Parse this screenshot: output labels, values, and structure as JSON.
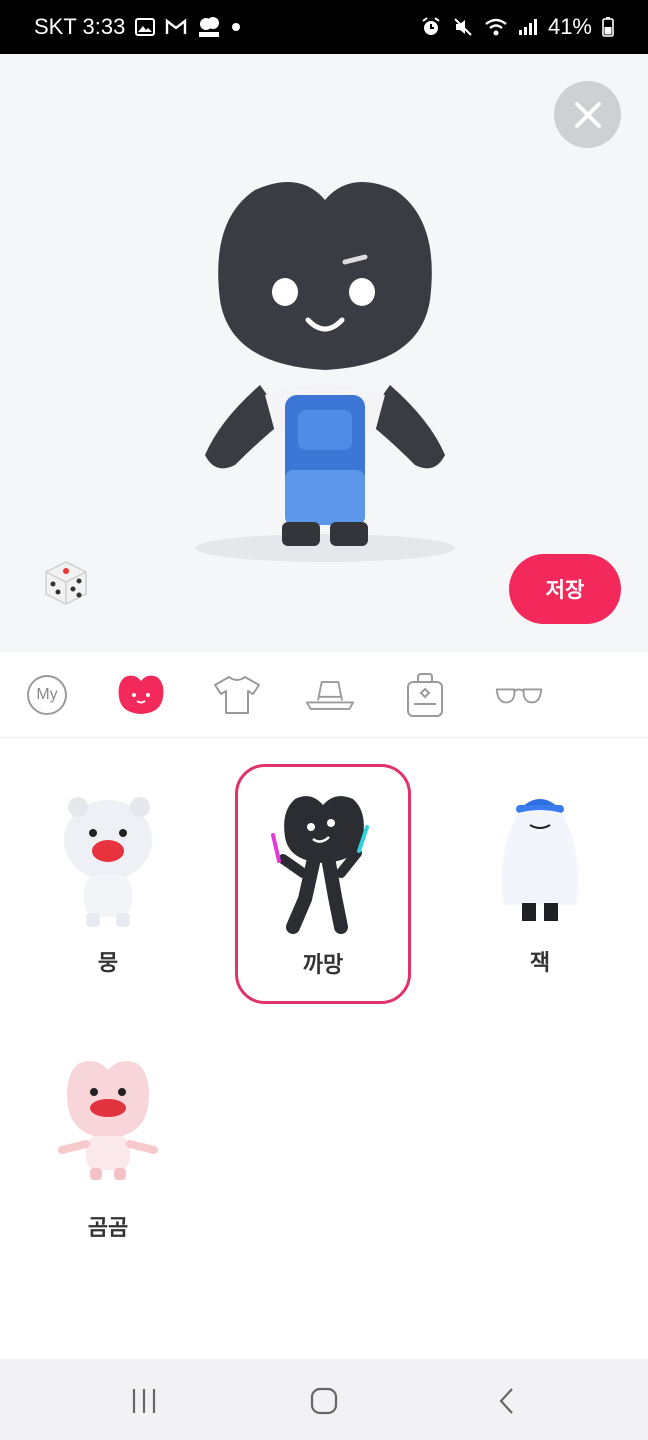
{
  "status": {
    "carrier_time": "SKT 3:33",
    "battery": "41%"
  },
  "preview": {
    "save_label": "저장"
  },
  "tabs": {
    "my_label": "My",
    "items": [
      "my-tab",
      "character-tab",
      "shirt-tab",
      "hat-tab",
      "bag-tab",
      "glasses-tab"
    ],
    "active": "character-tab"
  },
  "characters": [
    {
      "name": "뭉",
      "selected": false
    },
    {
      "name": "까망",
      "selected": true
    },
    {
      "name": "잭",
      "selected": false
    },
    {
      "name": "곰곰",
      "selected": false
    }
  ],
  "colors": {
    "accent": "#f2295a",
    "selected_border": "#e0336a",
    "preview_bg": "#f5f6f8"
  }
}
